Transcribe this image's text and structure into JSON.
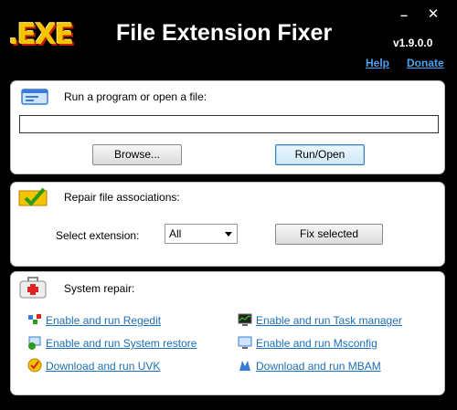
{
  "header": {
    "logo_text": ".EXE",
    "title": "File Extension Fixer",
    "version": "v1.9.0.0",
    "help_link": "Help",
    "donate_link": "Donate",
    "minimize_glyph": "–",
    "close_glyph": "✕"
  },
  "run_panel": {
    "title": "Run a program or open a file:",
    "input_value": "",
    "browse_label": "Browse...",
    "run_label": "Run/Open"
  },
  "repair_panel": {
    "title": "Repair file associations:",
    "select_label": "Select extension:",
    "selected_extension": "All",
    "fix_label": "Fix selected"
  },
  "system_panel": {
    "title": "System repair:",
    "links": [
      {
        "label": "Enable and run Regedit",
        "icon": "regedit-icon"
      },
      {
        "label": "Enable and run System restore",
        "icon": "system-restore-icon"
      },
      {
        "label": "Download and run UVK",
        "icon": "uvk-icon"
      },
      {
        "label": "Enable and run Task manager",
        "icon": "task-manager-icon"
      },
      {
        "label": "Enable and run Msconfig",
        "icon": "msconfig-icon"
      },
      {
        "label": "Download and run MBAM",
        "icon": "mbam-icon"
      }
    ]
  },
  "colors": {
    "background": "#000000",
    "link": "#1c6fb8",
    "top_link": "#4aa3f0",
    "logo_yellow": "#f3c400"
  }
}
